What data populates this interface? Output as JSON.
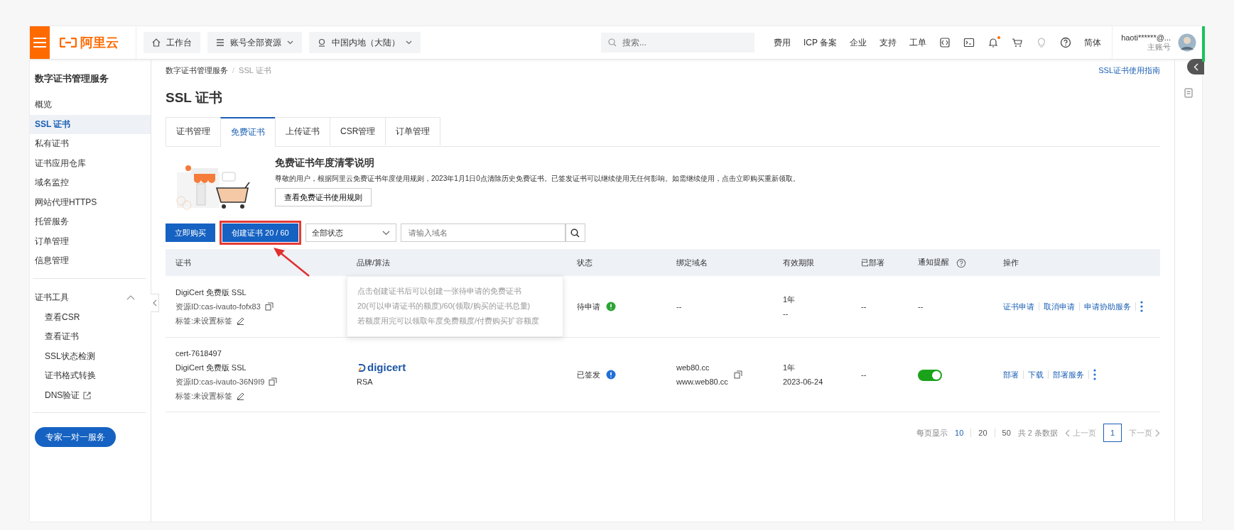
{
  "topbar": {
    "brand": "阿里云",
    "nav": [
      {
        "label": "工作台",
        "dropdown": false
      },
      {
        "label": "账号全部资源",
        "dropdown": true
      },
      {
        "label": "中国内地（大陆）",
        "dropdown": true
      }
    ],
    "search": {
      "placeholder": "搜索..."
    },
    "links": [
      "费用",
      "ICP 备案",
      "企业",
      "支持",
      "工单"
    ],
    "bell_dot": true,
    "language": "简体",
    "user": {
      "name": "haoti******@...",
      "role": "主账号"
    }
  },
  "sidebar": {
    "title": "数字证书管理服务",
    "items": [
      {
        "label": "概览",
        "selected": false
      },
      {
        "label": "SSL 证书",
        "selected": true
      },
      {
        "label": "私有证书",
        "selected": false
      },
      {
        "label": "证书应用仓库",
        "selected": false
      },
      {
        "label": "域名监控",
        "selected": false
      },
      {
        "label": "网站代理HTTPS",
        "selected": false
      },
      {
        "label": "托管服务",
        "selected": false
      },
      {
        "label": "订单管理",
        "selected": false
      },
      {
        "label": "信息管理",
        "selected": false
      }
    ],
    "tools": {
      "title": "证书工具",
      "expanded": true,
      "items": [
        {
          "label": "查看CSR",
          "external": false
        },
        {
          "label": "查看证书",
          "external": false
        },
        {
          "label": "SSL状态检测",
          "external": false
        },
        {
          "label": "证书格式转换",
          "external": false
        },
        {
          "label": "DNS验证",
          "external": true
        }
      ]
    },
    "cta": "专家一对一服务"
  },
  "main": {
    "breadcrumb": [
      "数字证书管理服务",
      "SSL 证书"
    ],
    "breadcrumb_separator": "/",
    "guide_link": "SSL证书使用指南",
    "title": "SSL 证书",
    "tabs": [
      {
        "label": "证书管理",
        "selected": false
      },
      {
        "label": "免费证书",
        "selected": true
      },
      {
        "label": "上传证书",
        "selected": false
      },
      {
        "label": "CSR管理",
        "selected": false
      },
      {
        "label": "订单管理",
        "selected": false
      }
    ],
    "notice": {
      "title": "免费证书年度清零说明",
      "text": "尊敬的用户，根据阿里云免费证书年度使用规则，2023年1月1日0点清除历史免费证书。已签发证书可以继续使用无任何影响。如需继续使用，点击立即购买重新领取。",
      "button": "查看免费证书使用规则"
    },
    "toolbar": {
      "buy": "立即购买",
      "create": "创建证书 20 / 60",
      "status_filter": "全部状态",
      "search": {
        "placeholder": "请输入域名"
      }
    },
    "tooltip": [
      "点击创建证书后可以创建一张待申请的免费证书",
      "20(可以申请证书的额度)/60(领取/购买的证书总量)",
      "若额度用完可以领取年度免费额度/付费购买扩容额度"
    ],
    "table": {
      "columns": [
        "证书",
        "品牌/算法",
        "状态",
        "绑定域名",
        "有效期限",
        "已部署",
        "通知提醒",
        "操作"
      ],
      "rows": [
        {
          "product": "DigiCert 免费版 SSL",
          "resource_id": "资源ID:cas-ivauto-fofx83",
          "tag": "标签:未设置标签",
          "status": {
            "label": "待申请",
            "kind": "pending"
          },
          "domains": [
            "--"
          ],
          "domain_copy": false,
          "validity": [
            "1年",
            "--"
          ],
          "deployed": "--",
          "notify": {
            "kind": "text",
            "text": "--"
          },
          "actions": [
            "证书申请",
            "取消申请",
            "申请协助服务"
          ]
        },
        {
          "cert_id": "cert-7618497",
          "product": "DigiCert 免费版 SSL",
          "resource_id": "资源ID:cas-ivauto-36N9I9",
          "tag": "标签:未设置标签",
          "brand": {
            "logo": "digicert",
            "algorithm": "RSA"
          },
          "status": {
            "label": "已签发",
            "kind": "issued"
          },
          "domains": [
            "web80.cc",
            "www.web80.cc"
          ],
          "domain_copy": true,
          "validity": [
            "1年",
            "2023-06-24"
          ],
          "deployed": "--",
          "notify": {
            "kind": "switch",
            "on": true
          },
          "actions": [
            "部署",
            "下载",
            "部署服务"
          ]
        }
      ]
    },
    "pagination": {
      "label": "每页显示",
      "sizes": [
        {
          "label": "10",
          "selected": true
        },
        {
          "label": "20",
          "selected": false
        },
        {
          "label": "50",
          "selected": false
        }
      ],
      "total": "共 2 条数据",
      "prev": "上一页",
      "pages": [
        {
          "label": "1",
          "selected": true
        }
      ],
      "next": "下一页"
    }
  }
}
